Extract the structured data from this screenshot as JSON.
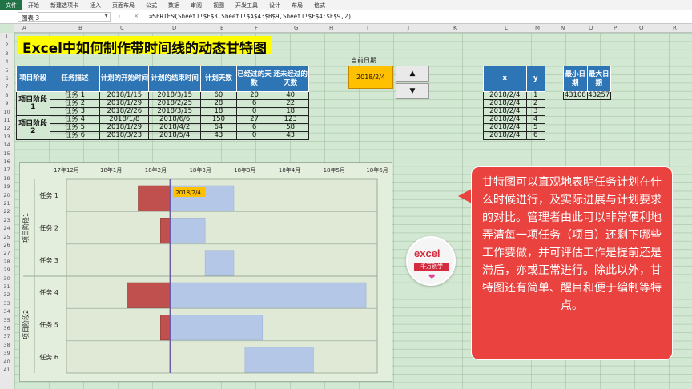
{
  "ribbon_tabs": [
    "文件",
    "开始",
    "新建选项卡",
    "插入",
    "页面布局",
    "公式",
    "数据",
    "审阅",
    "视图",
    "开发工具",
    "设计",
    "布局",
    "格式"
  ],
  "name_box": "图表 3",
  "formula": "=SERIES(Sheet1!$F$3,Sheet1!$A$4:$B$9,Sheet1!$F$4:$F$9,2)",
  "columns": [
    "A",
    "B",
    "C",
    "D",
    "E",
    "F",
    "G",
    "H",
    "I",
    "J",
    "K",
    "L",
    "M",
    "N",
    "O",
    "P",
    "Q",
    "R"
  ],
  "rows": [
    "1",
    "2",
    "3",
    "4",
    "5",
    "6",
    "7",
    "8",
    "9",
    "10",
    "11",
    "12",
    "13",
    "14",
    "15",
    "16",
    "17",
    "18",
    "19",
    "20",
    "21",
    "22",
    "23",
    "24",
    "25",
    "26",
    "27",
    "28",
    "29",
    "30",
    "31",
    "32",
    "33",
    "34",
    "35",
    "36",
    "37",
    "38",
    "39",
    "40",
    "41"
  ],
  "title": "Excel中如何制作带时间线的动态甘特图",
  "table": {
    "headers": [
      "项目阶段",
      "任务描述",
      "计划的开始时间",
      "计划的结束时间",
      "计划天数",
      "已经过的天数",
      "还未经过的天数"
    ],
    "phase1": "项目阶段1",
    "phase2": "项目阶段2",
    "rows": [
      [
        "任务 1",
        "2018/1/15",
        "2018/3/15",
        "60",
        "20",
        "40"
      ],
      [
        "任务 2",
        "2018/1/29",
        "2018/2/25",
        "28",
        "6",
        "22"
      ],
      [
        "任务 3",
        "2018/2/26",
        "2018/3/15",
        "18",
        "0",
        "18"
      ],
      [
        "任务 4",
        "2018/1/8",
        "2018/6/6",
        "150",
        "27",
        "123"
      ],
      [
        "任务 5",
        "2018/1/29",
        "2018/4/2",
        "64",
        "6",
        "58"
      ],
      [
        "任务 6",
        "2018/3/23",
        "2018/5/4",
        "43",
        "0",
        "43"
      ]
    ]
  },
  "current_date_label": "当前日期",
  "current_date": "2018/2/4",
  "spinner": {
    "up": "▲",
    "down": "▼"
  },
  "xy_table": {
    "headers": [
      "x",
      "y"
    ],
    "rows": [
      [
        "2018/2/4",
        "1"
      ],
      [
        "2018/2/4",
        "2"
      ],
      [
        "2018/2/4",
        "3"
      ],
      [
        "2018/2/4",
        "4"
      ],
      [
        "2018/2/4",
        "5"
      ],
      [
        "2018/2/4",
        "6"
      ]
    ]
  },
  "minmax": {
    "headers": [
      "最小日期",
      "最大日期"
    ],
    "values": [
      "43108",
      "43257"
    ]
  },
  "chart_data": {
    "type": "bar",
    "x_axis_ticks": [
      "17年12月",
      "18年1月",
      "18年2月",
      "18年3月",
      "18年3月",
      "18年4月",
      "18年5月",
      "18年6月"
    ],
    "group_labels": [
      "项目阶段1",
      "项目阶段2"
    ],
    "categories": [
      "任务 1",
      "任务 2",
      "任务 3",
      "任务 4",
      "任务 5",
      "任务 6"
    ],
    "axis_min": 43070,
    "axis_max": 43265,
    "tick_values": [
      43070,
      43098,
      43126,
      43154,
      43182,
      43210,
      43238,
      43265
    ],
    "current_date_serial": 43135,
    "current_date_label": "2018/2/4",
    "series": [
      {
        "name": "已经过的天数",
        "color": "#c0504d",
        "starts": [
          43115,
          43129,
          43157,
          43108,
          43129,
          43182
        ],
        "values": [
          20,
          6,
          0,
          27,
          6,
          0
        ]
      },
      {
        "name": "还未经过的天数",
        "color": "#b4c7e7",
        "starts": [
          43135,
          43135,
          43157,
          43135,
          43135,
          43182
        ],
        "values": [
          40,
          22,
          18,
          123,
          58,
          43
        ]
      }
    ]
  },
  "callout_text": "甘特图可以直观地表明任务计划在什么时候进行，及实际进展与计划要求的对比。管理者由此可以非常便利地弄清每一项任务（项目）还剩下哪些工作要做，并可评估工作是提前还是滞后，亦或正常进行。除此以外，甘特图还有简单、醒目和便于编制等特点。",
  "logo": {
    "line1": "excel",
    "line2": "千万别学",
    "heart": "❤"
  }
}
